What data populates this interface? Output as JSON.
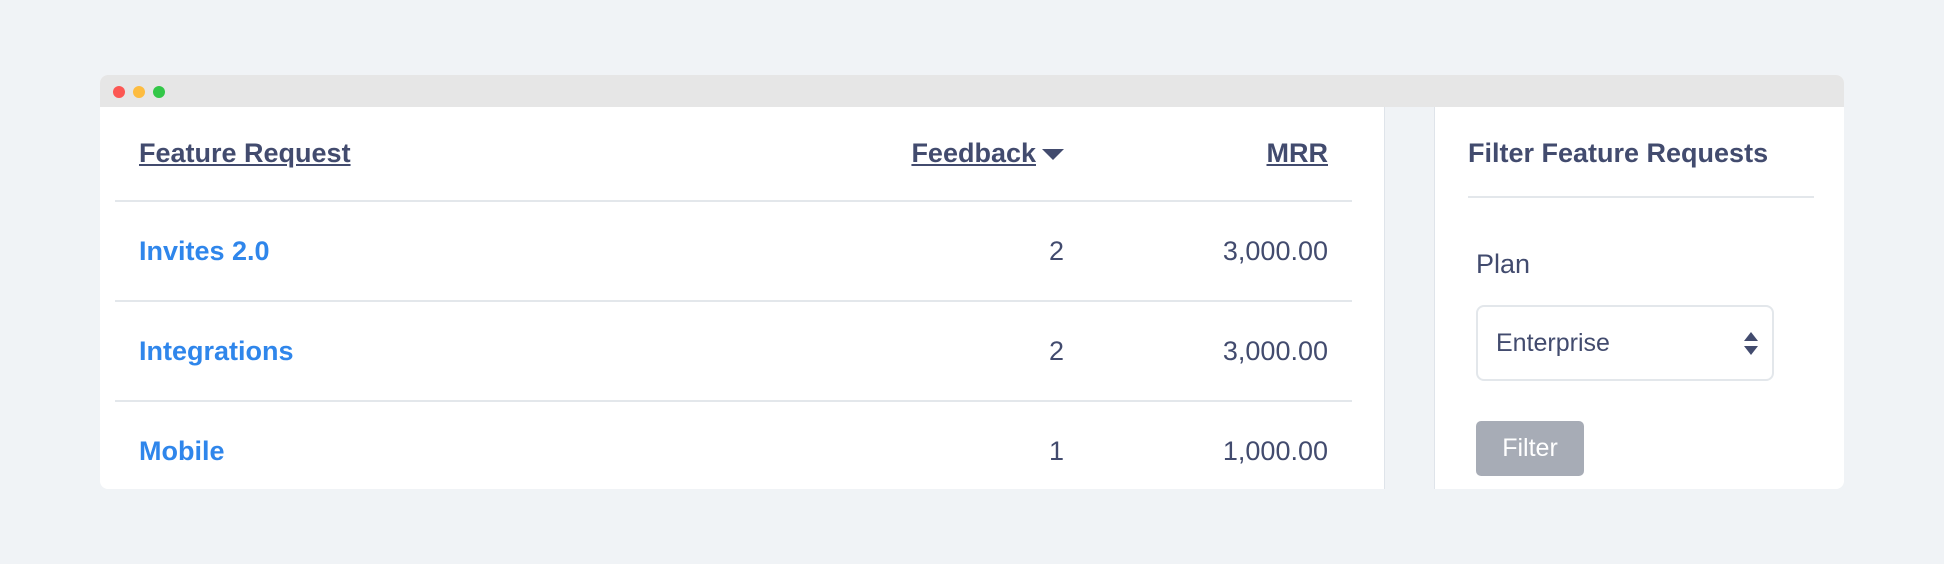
{
  "table": {
    "headers": {
      "feature": "Feature Request",
      "feedback": "Feedback",
      "mrr": "MRR"
    },
    "sort": {
      "column": "feedback",
      "direction": "descending",
      "icon": "caret-down-icon"
    },
    "rows": [
      {
        "feature": "Invites 2.0",
        "feedback": "2",
        "mrr": "3,000.00"
      },
      {
        "feature": "Integrations",
        "feedback": "2",
        "mrr": "3,000.00"
      },
      {
        "feature": "Mobile",
        "feedback": "1",
        "mrr": "1,000.00"
      }
    ]
  },
  "sidebar": {
    "title": "Filter Feature Requests",
    "plan_label": "Plan",
    "plan_selected": "Enterprise",
    "filter_button": "Filter"
  },
  "colors": {
    "background": "#f0f3f6",
    "text": "#424b6e",
    "link": "#2f86eb",
    "button_disabled": "#a7acb6"
  }
}
